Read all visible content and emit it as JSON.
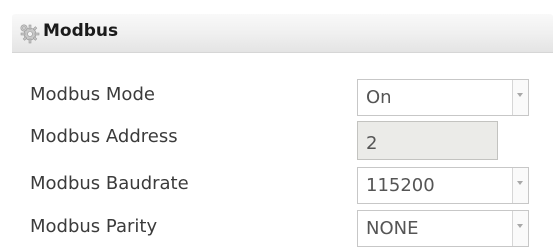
{
  "panel": {
    "title": "Modbus",
    "icon": "gear-icon"
  },
  "fields": [
    {
      "label": "Modbus Mode",
      "value": "On"
    },
    {
      "label": "Modbus Address",
      "value": "2"
    },
    {
      "label": "Modbus Baudrate",
      "value": "115200"
    },
    {
      "label": "Modbus Parity",
      "value": "NONE"
    }
  ]
}
